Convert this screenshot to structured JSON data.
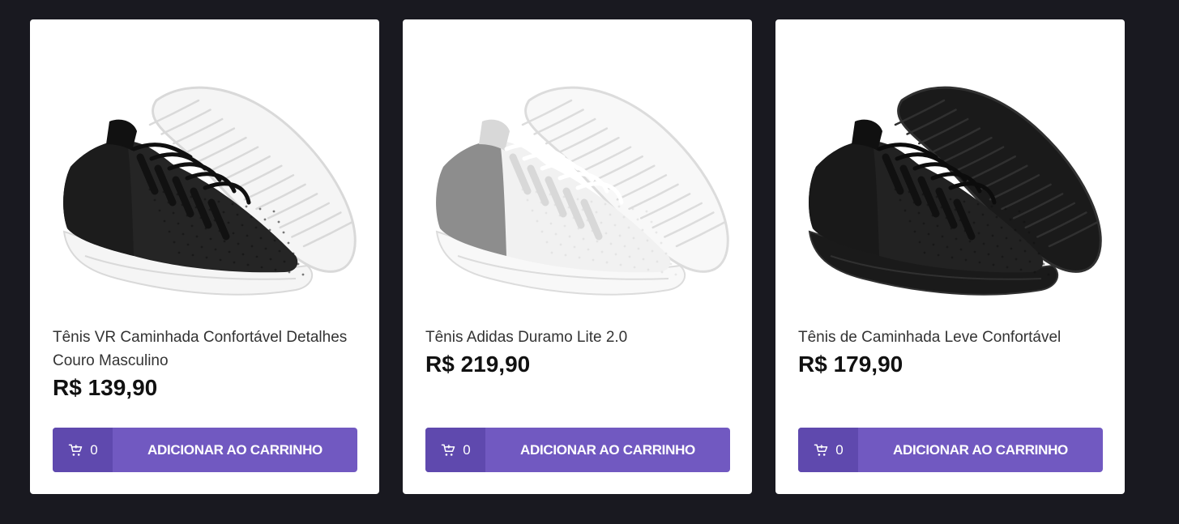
{
  "colors": {
    "page_background": "#191920",
    "card_background": "#ffffff",
    "button_accent": "#7159c1",
    "button_count_area": "#5f49ae"
  },
  "icons": {
    "cart": "add-shopping-cart-icon"
  },
  "products": [
    {
      "title": "Tênis VR Caminhada Confortável Detalhes Couro Masculino",
      "price": "R$ 139,90",
      "cart_count": "0",
      "button_label": "ADICIONAR AO CARRINHO",
      "image_name": "black-white-sneaker-image",
      "shoe_colors": {
        "upper": "#252525",
        "upper_dark": "#111111",
        "sole": "#f5f5f5",
        "sole_shadow": "#d9d9d9",
        "panel": "#1c1c1c",
        "laces": "#0f0f0f"
      }
    },
    {
      "title": "Tênis Adidas Duramo Lite 2.0",
      "price": "R$ 219,90",
      "cart_count": "0",
      "button_label": "ADICIONAR AO CARRINHO",
      "image_name": "white-grey-sneaker-image",
      "shoe_colors": {
        "upper": "#f1f1f1",
        "upper_dark": "#d8d8d8",
        "sole": "#f8f8f8",
        "sole_shadow": "#dcdcdc",
        "panel": "#8d8d8d",
        "laces": "#ffffff"
      }
    },
    {
      "title": "Tênis de Caminhada Leve Confortável",
      "price": "R$ 179,90",
      "cart_count": "0",
      "button_label": "ADICIONAR AO CARRINHO",
      "image_name": "all-black-sneaker-image",
      "shoe_colors": {
        "upper": "#222222",
        "upper_dark": "#101010",
        "sole": "#1a1a1a",
        "sole_shadow": "#303030",
        "panel": "#191919",
        "laces": "#0c0c0c"
      }
    }
  ]
}
